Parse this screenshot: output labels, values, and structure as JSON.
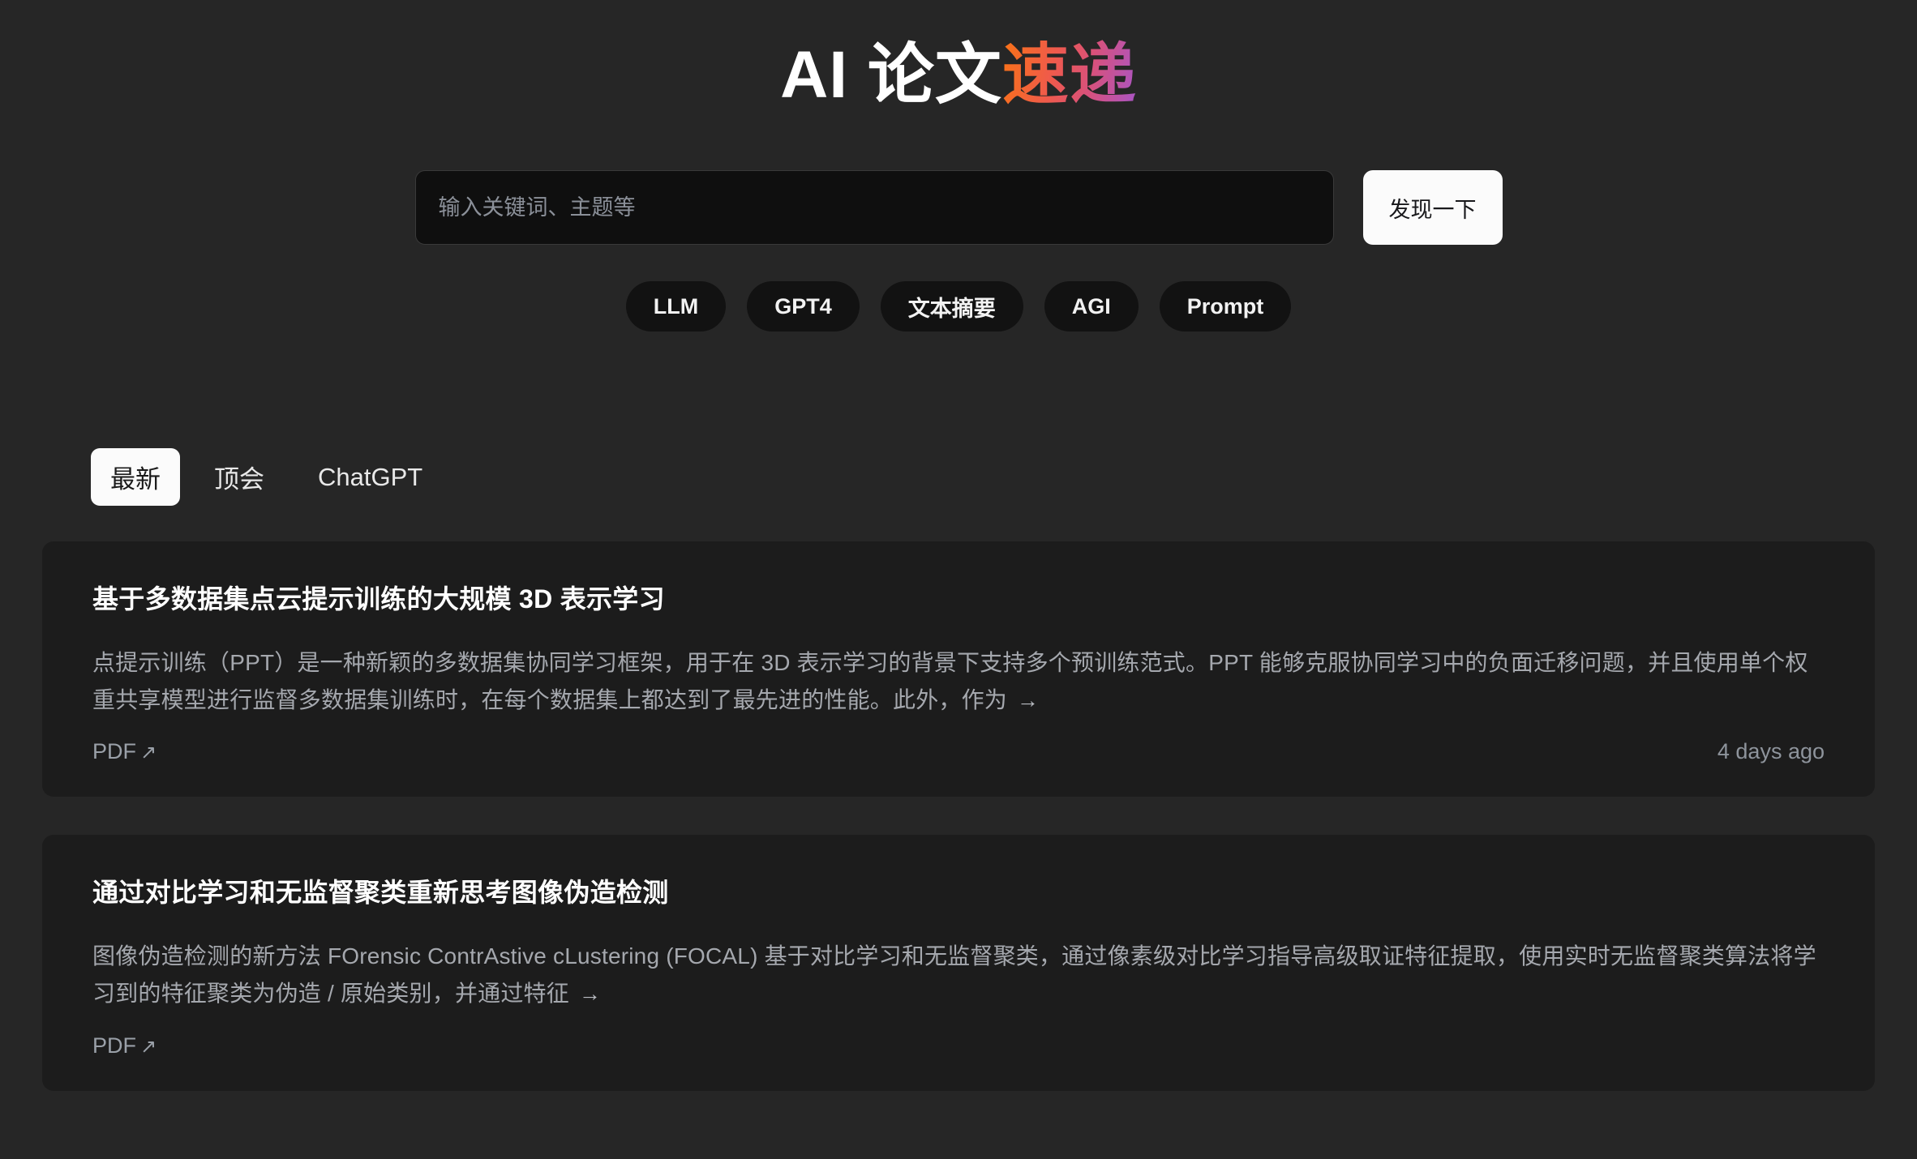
{
  "header": {
    "title_plain": "AI 论文",
    "title_accent": "速递",
    "gradient_from": "#f97316",
    "gradient_to": "#a855c7"
  },
  "search": {
    "placeholder": "输入关键词、主题等",
    "value": "",
    "button_label": "发现一下"
  },
  "tags": [
    {
      "label": "LLM"
    },
    {
      "label": "GPT4"
    },
    {
      "label": "文本摘要"
    },
    {
      "label": "AGI"
    },
    {
      "label": "Prompt"
    }
  ],
  "tabs": [
    {
      "label": "最新",
      "active": true
    },
    {
      "label": "顶会",
      "active": false
    },
    {
      "label": "ChatGPT",
      "active": false
    }
  ],
  "papers": [
    {
      "title": "基于多数据集点云提示训练的大规模 3D 表示学习",
      "abstract": "点提示训练（PPT）是一种新颖的多数据集协同学习框架，用于在 3D 表示学习的背景下支持多个预训练范式。PPT 能够克服协同学习中的负面迁移问题，并且使用单个权重共享模型进行监督多数据集训练时，在每个数据集上都达到了最先进的性能。此外，作为",
      "more_arrow": "→",
      "pdf_label": "PDF",
      "pdf_arrow": "↗",
      "time": "4 days ago"
    },
    {
      "title": "通过对比学习和无监督聚类重新思考图像伪造检测",
      "abstract": "图像伪造检测的新方法 FOrensic ContrAstive cLustering (FOCAL) 基于对比学习和无监督聚类，通过像素级对比学习指导高级取证特征提取，使用实时无监督聚类算法将学习到的特征聚类为伪造 / 原始类别，并通过特征",
      "more_arrow": "→",
      "pdf_label": "PDF",
      "pdf_arrow": "↗",
      "time": ""
    }
  ]
}
